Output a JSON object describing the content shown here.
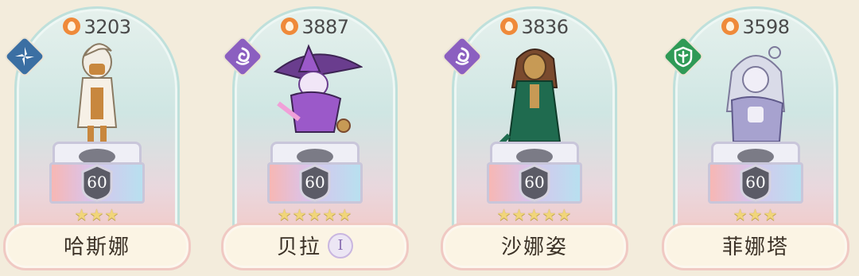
{
  "heroes": [
    {
      "power": "3203",
      "element": "wind",
      "element_icon": "wind-shuriken-icon",
      "element_color": "#3b6fa3",
      "level": "60",
      "stars": "★★★",
      "name": "哈斯娜",
      "rank": "",
      "sprite_colors": [
        "#f2ede4",
        "#c8873e",
        "#f6f0e6"
      ]
    },
    {
      "power": "3887",
      "element": "arcane",
      "element_icon": "arcane-swirl-icon",
      "element_color": "#8b5fc0",
      "level": "60",
      "stars": "★★★★★",
      "name": "贝拉",
      "rank": "I",
      "sprite_colors": [
        "#9b59c9",
        "#f1e6f7",
        "#6a3d8e"
      ]
    },
    {
      "power": "3836",
      "element": "arcane",
      "element_icon": "arcane-swirl-icon",
      "element_color": "#8b5fc0",
      "level": "60",
      "stars": "★★★★★",
      "name": "沙娜姿",
      "rank": "",
      "sprite_colors": [
        "#1f6b4f",
        "#7a4a2e",
        "#c79a55"
      ]
    },
    {
      "power": "3598",
      "element": "nature",
      "element_icon": "nature-shield-icon",
      "element_color": "#2f9a56",
      "level": "60",
      "stars": "★★★",
      "name": "菲娜塔",
      "rank": "",
      "sprite_colors": [
        "#d9dbe8",
        "#a7a2cf",
        "#f0eef7"
      ]
    }
  ]
}
